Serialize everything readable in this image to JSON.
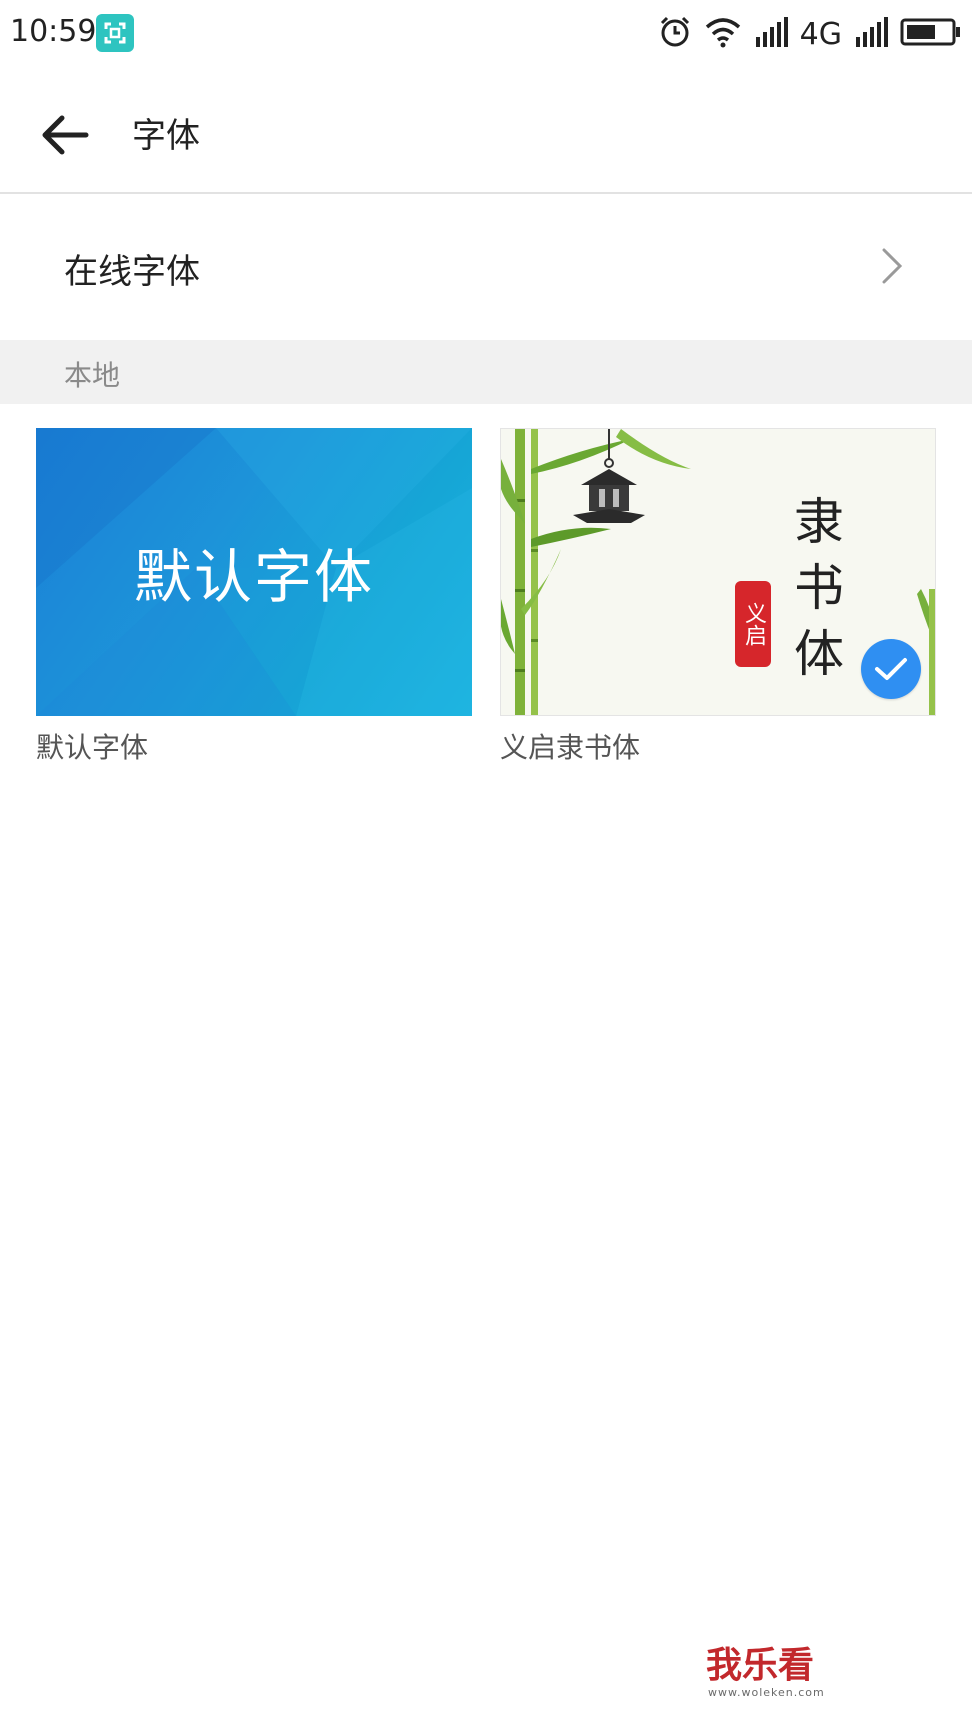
{
  "status_bar": {
    "time": "10:59",
    "network": "4G",
    "app_icon": "screenshot-app-icon",
    "icons": [
      "alarm-icon",
      "wifi-icon",
      "signal-icon",
      "signal-icon",
      "battery-icon"
    ]
  },
  "header": {
    "title": "字体",
    "back_icon": "arrow-left-icon"
  },
  "online_fonts": {
    "label": "在线字体",
    "chevron_icon": "chevron-right-icon"
  },
  "local_section": {
    "label": "本地"
  },
  "fonts": [
    {
      "preview_text": "默认字体",
      "caption": "默认字体",
      "selected": false
    },
    {
      "preview_text": "隶书体",
      "seal_text": "义启",
      "caption": "义启隶书体",
      "selected": true
    }
  ],
  "watermark": {
    "text": "我乐看",
    "subtext": "www.woleken.com"
  },
  "colors": {
    "accent": "#2f8ff2",
    "default_thumb_blue": "#1a7fd6",
    "seal_red": "#d6262b",
    "watermark_red": "#c2282c",
    "section_bg": "#f1f1f1"
  }
}
